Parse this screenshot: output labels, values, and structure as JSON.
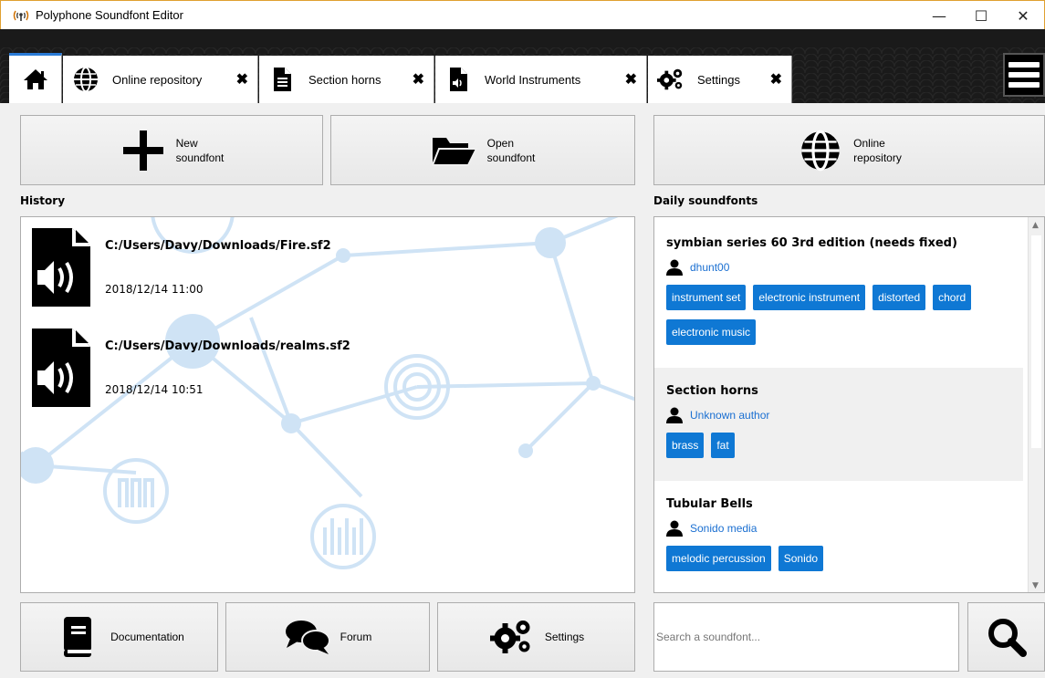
{
  "window": {
    "title": "Polyphone Soundfont Editor",
    "minimize": "—",
    "maximize": "☐",
    "close": "✕"
  },
  "tabs": [
    {
      "label": "Online repository",
      "icon": "globe-icon",
      "close": "✖"
    },
    {
      "label": "Section horns",
      "icon": "document-icon",
      "close": "✖"
    },
    {
      "label": "World Instruments",
      "icon": "audio-file-icon",
      "close": "✖"
    },
    {
      "label": "Settings",
      "icon": "gears-icon",
      "close": "✖"
    }
  ],
  "toolbar": {
    "new_line1": "New",
    "new_line2": "soundfont",
    "open_line1": "Open",
    "open_line2": "soundfont",
    "online_line1": "Online",
    "online_line2": "repository"
  },
  "history": {
    "label": "History",
    "items": [
      {
        "path": "C:/Users/Davy/Downloads/Fire.sf2",
        "date": "2018/12/14 11:00"
      },
      {
        "path": "C:/Users/Davy/Downloads/realms.sf2",
        "date": "2018/12/14 10:51"
      }
    ]
  },
  "daily": {
    "label": "Daily soundfonts",
    "items": [
      {
        "title": "symbian series 60 3rd edition (needs fixed)",
        "author": "dhunt00",
        "tags": [
          "instrument set",
          "electronic instrument",
          "distorted",
          "chord",
          "electronic music"
        ]
      },
      {
        "title": "Section horns",
        "author": "Unknown author",
        "tags": [
          "brass",
          "fat"
        ]
      },
      {
        "title": "Tubular Bells",
        "author": "Sonido media",
        "tags": [
          "melodic percussion",
          "Sonido"
        ]
      }
    ]
  },
  "footer": {
    "documentation": "Documentation",
    "forum": "Forum",
    "settings": "Settings"
  },
  "search": {
    "placeholder": "Search a soundfont..."
  },
  "colors": {
    "accent": "#0f78d4",
    "tab_strip": "#1a1a1a",
    "decor": "#cfe3f5"
  }
}
